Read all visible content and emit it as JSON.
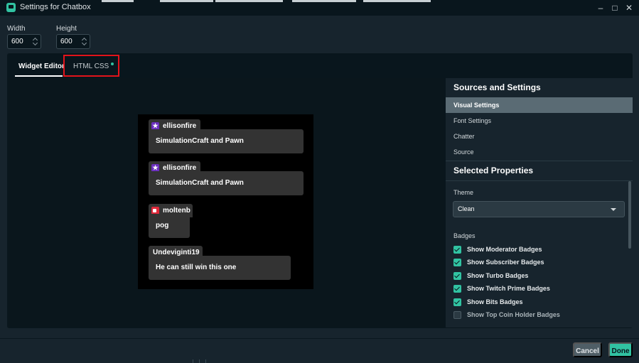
{
  "window": {
    "title": "Settings for Chatbox",
    "accent": "#31c3a2"
  },
  "dimensions": {
    "width_label": "Width",
    "width_value": "600",
    "height_label": "Height",
    "height_value": "600"
  },
  "tabs": [
    {
      "label": "Widget Editor",
      "active": true
    },
    {
      "label": "HTML CSS",
      "active": false,
      "modified_dot": true
    }
  ],
  "chat": {
    "messages": [
      {
        "user": "ellisonfire",
        "badge": "star-badge-icon",
        "text": "SimulationCraft and Pawn"
      },
      {
        "user": "ellisonfire",
        "badge": "star-badge-icon",
        "text": "SimulationCraft and Pawn"
      },
      {
        "user": "moltenb",
        "badge": "camera-badge-icon",
        "text": "pog"
      },
      {
        "user": "Undeviginti19",
        "badge": "",
        "text": "He can still win this one"
      }
    ]
  },
  "sidebar": {
    "sources_heading": "Sources and Settings",
    "items": [
      {
        "label": "Visual Settings",
        "selected": true
      },
      {
        "label": "Font Settings",
        "selected": false
      },
      {
        "label": "Chatter",
        "selected": false
      },
      {
        "label": "Source",
        "selected": false
      }
    ],
    "selected_heading": "Selected Properties",
    "theme_label": "Theme",
    "theme_value": "Clean",
    "badges_label": "Badges",
    "badges": [
      {
        "label": "Show Moderator Badges",
        "checked": true
      },
      {
        "label": "Show Subscriber Badges",
        "checked": true
      },
      {
        "label": "Show Turbo Badges",
        "checked": true
      },
      {
        "label": "Show Twitch Prime Badges",
        "checked": true
      },
      {
        "label": "Show Bits Badges",
        "checked": true
      },
      {
        "label": "Show Top Coin Holder Badges",
        "checked": false
      }
    ]
  },
  "footer": {
    "cancel_label": "Cancel",
    "done_label": "Done"
  }
}
